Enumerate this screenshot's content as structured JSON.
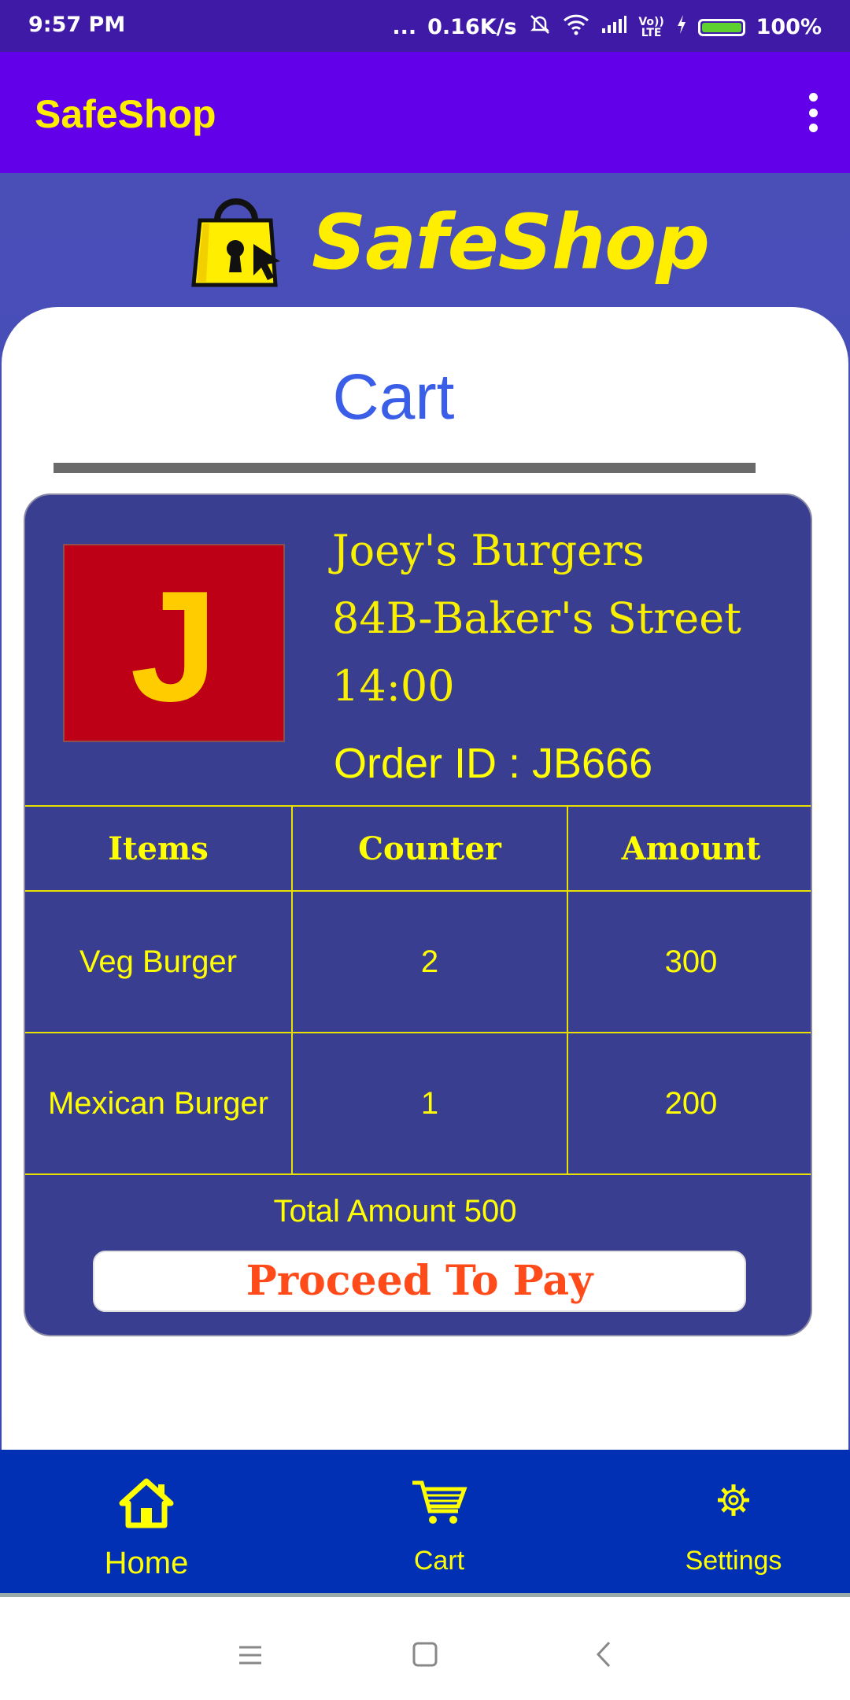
{
  "status_bar": {
    "time": "9:57 PM",
    "dots": "...",
    "network_speed": "0.16K/s",
    "volte": "Vo)) LTE",
    "battery": "100%",
    "battery_level": 1.0,
    "icons": [
      "mute-icon",
      "wifi-icon",
      "signal-icon",
      "charging-icon",
      "battery-icon"
    ]
  },
  "app_bar": {
    "title": "SafeShop",
    "menu_icon": "overflow-menu-icon"
  },
  "hero": {
    "logo_text": "SafeShop",
    "logo_icon": "shopping-bag-lock-icon"
  },
  "page": {
    "title": "Cart"
  },
  "store": {
    "logo_letter": "J",
    "name": "Joey's Burgers",
    "address": "84B-Baker's Street",
    "time": "14:00",
    "order_id": "Order ID : JB666"
  },
  "table": {
    "headers": [
      "Items",
      "Counter",
      "Amount"
    ],
    "rows": [
      [
        "Veg Burger",
        "2",
        "300"
      ],
      [
        "Mexican Burger",
        "1",
        "200"
      ]
    ]
  },
  "total": "Total Amount 500",
  "pay_button": "Proceed To Pay",
  "bottom_nav": {
    "items": [
      {
        "label": "Home",
        "icon": "home-icon"
      },
      {
        "label": "Cart",
        "icon": "cart-icon"
      },
      {
        "label": "Settings",
        "icon": "gear-icon"
      }
    ]
  },
  "colors": {
    "app_bar": "#6200ea",
    "accent_yellow": "#ffee00",
    "card": "#3a3e91",
    "bottom_nav": "#0230b4",
    "pay_text": "#ff4a1a"
  }
}
